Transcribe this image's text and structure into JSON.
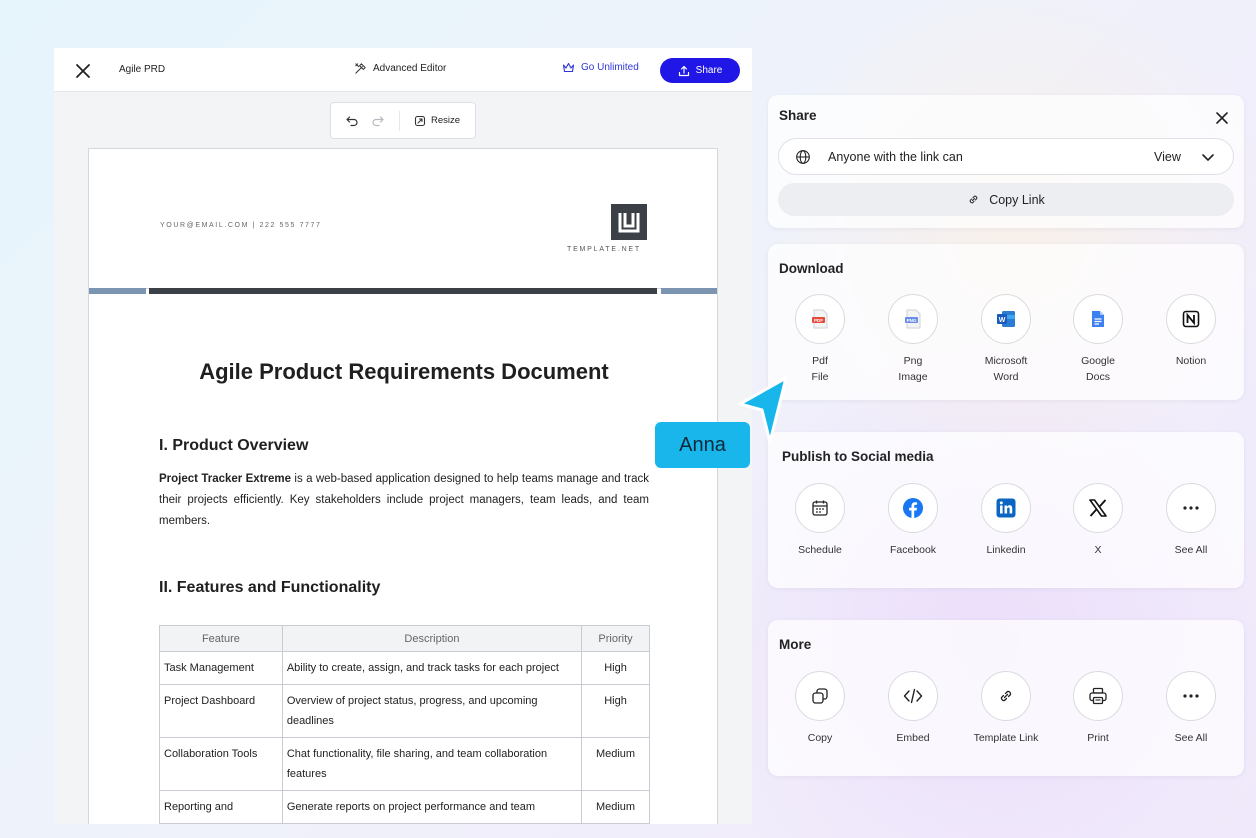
{
  "editor": {
    "doc_title": "Agile PRD",
    "advanced_editor": "Advanced Editor",
    "go_unlimited": "Go Unlimited",
    "share": "Share",
    "resize": "Resize"
  },
  "document": {
    "contact": "YOUR@EMAIL.COM | 222 555 7777",
    "logo_text": "TEMPLATE.NET",
    "title": "Agile Product Requirements Document",
    "section1": "I. Product Overview",
    "overview_bold": "Project Tracker Extreme",
    "overview_text": " is a web-based application designed to help teams manage and track their projects efficiently. Key stakeholders include project managers, team leads, and team members.",
    "section2": "II. Features and Functionality",
    "table": {
      "headers": [
        "Feature",
        "Description",
        "Priority"
      ],
      "rows": [
        [
          "Task Management",
          "Ability to create, assign, and track tasks for each project",
          "High"
        ],
        [
          "Project Dashboard",
          "Overview of project status, progress, and upcoming deadlines",
          "High"
        ],
        [
          "Collaboration Tools",
          "Chat functionality, file sharing, and team collaboration features",
          "Medium"
        ],
        [
          "Reporting and",
          "Generate reports on project performance and team",
          "Medium"
        ]
      ]
    }
  },
  "share_panel": {
    "title": "Share",
    "link_access": "Anyone with the link can",
    "permission": "View",
    "copy_link": "Copy Link"
  },
  "download_panel": {
    "title": "Download",
    "items": [
      {
        "label1": "Pdf",
        "label2": "File",
        "icon": "pdf-icon"
      },
      {
        "label1": "Png",
        "label2": "Image",
        "icon": "png-icon"
      },
      {
        "label1": "Microsoft",
        "label2": "Word",
        "icon": "word-icon"
      },
      {
        "label1": "Google",
        "label2": "Docs",
        "icon": "google-docs-icon"
      },
      {
        "label1": "Notion",
        "label2": "",
        "icon": "notion-icon"
      }
    ]
  },
  "social_panel": {
    "title": "Publish to Social media",
    "items": [
      {
        "label": "Schedule",
        "icon": "calendar-icon"
      },
      {
        "label": "Facebook",
        "icon": "facebook-icon"
      },
      {
        "label": "Linkedin",
        "icon": "linkedin-icon"
      },
      {
        "label": "X",
        "icon": "x-icon"
      },
      {
        "label": "See All",
        "icon": "more-icon"
      }
    ]
  },
  "more_panel": {
    "title": "More",
    "items": [
      {
        "label": "Copy",
        "icon": "copy-icon"
      },
      {
        "label": "Embed",
        "icon": "code-icon"
      },
      {
        "label": "Template Link",
        "icon": "link-icon"
      },
      {
        "label": "Print",
        "icon": "printer-icon"
      },
      {
        "label": "See All",
        "icon": "more-icon"
      }
    ]
  },
  "collaborator": {
    "name": "Anna",
    "color": "#18b6ea"
  },
  "colors": {
    "accent": "#2017e6",
    "header_bar_dark": "#3b3f46",
    "header_bar_light": "#7b95b0"
  }
}
